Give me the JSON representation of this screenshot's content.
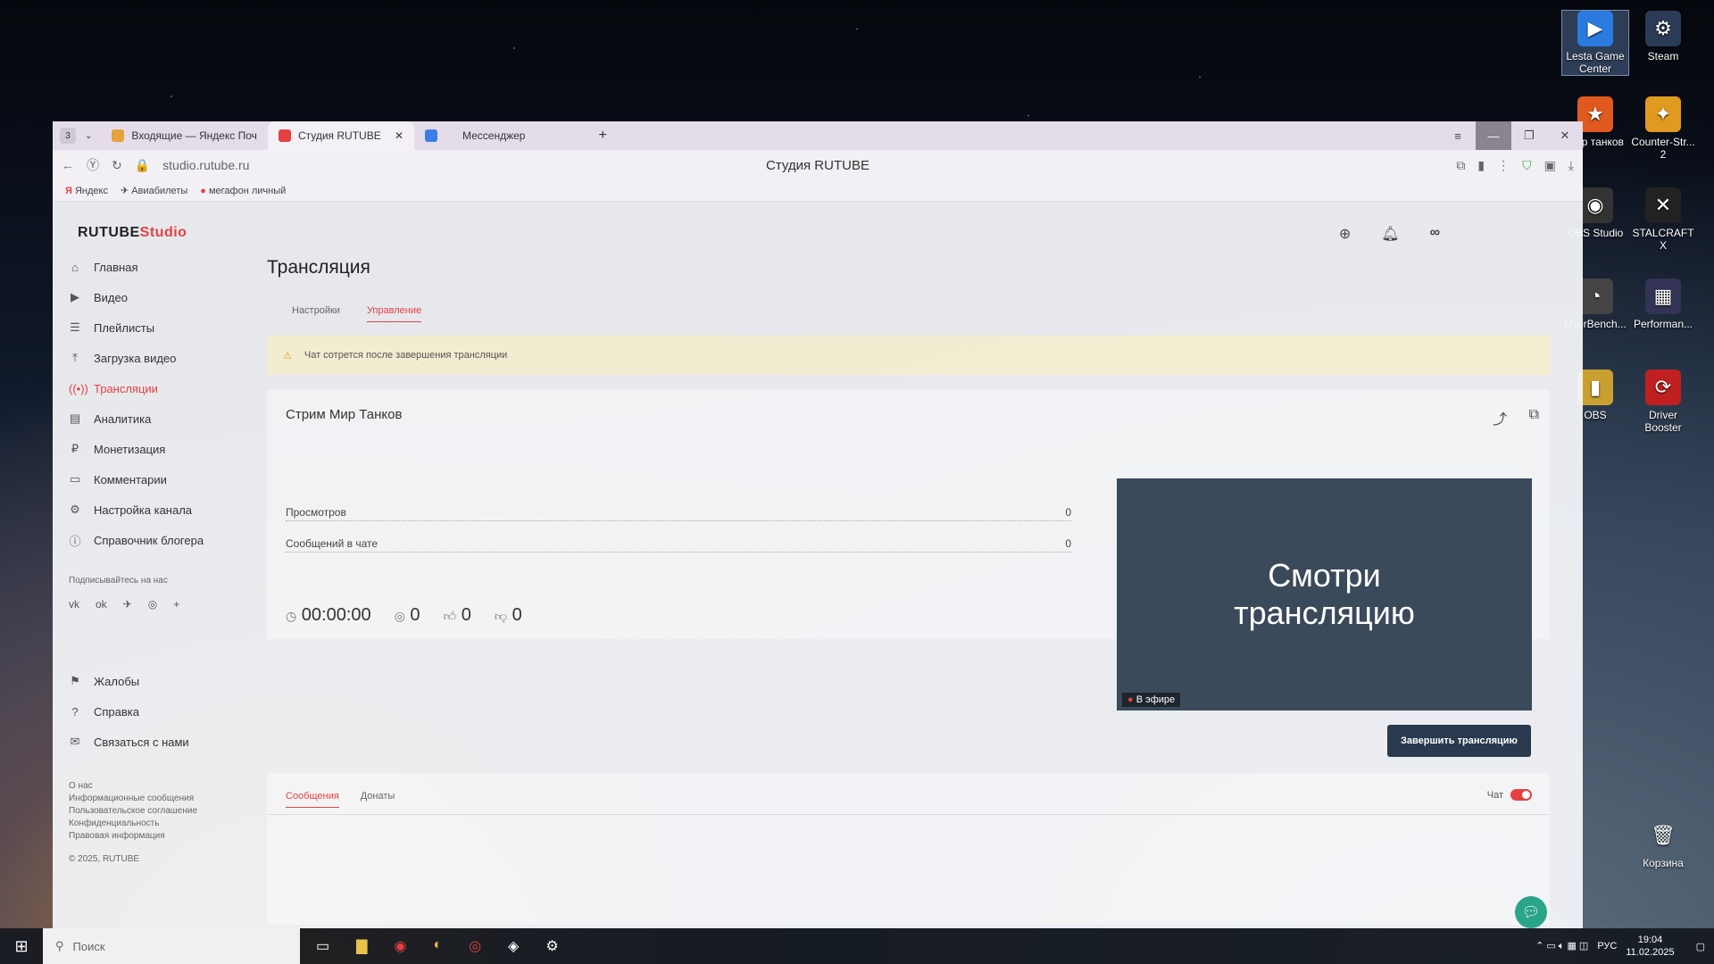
{
  "desktop": {
    "icons": [
      {
        "label": "Lesta Game Center",
        "glyph": "▶",
        "color": "#2a7ae0"
      },
      {
        "label": "Steam",
        "glyph": "⚙",
        "color": "#2a3b55"
      },
      {
        "label": "Мир танков",
        "glyph": "★",
        "color": "#e05a20"
      },
      {
        "label": "Counter-Str... 2",
        "glyph": "✦",
        "color": "#e09a20"
      },
      {
        "label": "OBS Studio",
        "glyph": "◉",
        "color": "#333"
      },
      {
        "label": "STALCRAFT X",
        "glyph": "✕",
        "color": "#222"
      },
      {
        "label": "UserBench...",
        "glyph": "◔",
        "color": "#444"
      },
      {
        "label": "Performan...",
        "glyph": "▦",
        "color": "#335"
      },
      {
        "label": "OBS",
        "glyph": "▮",
        "color": "#c9a030"
      },
      {
        "label": "Driver Booster",
        "glyph": "⟳",
        "color": "#c02020"
      },
      {
        "label": "Корзина",
        "glyph": "🗑",
        "color": "transparent"
      }
    ]
  },
  "browser": {
    "tab_count": "3",
    "tabs": [
      {
        "label": "Входящие — Яндекс Поч"
      },
      {
        "label": "Студия RUTUBE"
      },
      {
        "label": "Мессенджер"
      }
    ],
    "url": "studio.rutube.ru",
    "page_title": "Студия RUTUBE",
    "bookmarks": [
      "Яндекс",
      "Авиабилеты",
      "мегафон личный"
    ]
  },
  "studio": {
    "logo_main": "RUTUBE",
    "logo_accent": "Studio",
    "nav": [
      "Главная",
      "Видео",
      "Плейлисты",
      "Загрузка видео",
      "Трансляции",
      "Аналитика",
      "Монетизация",
      "Комментарии",
      "Настройка канала",
      "Справочник блогера"
    ],
    "subscribe_label": "Подписывайтесь на нас",
    "social": [
      "vk",
      "ok",
      "tg",
      "wa",
      "+"
    ],
    "bottom_nav": [
      "Жалобы",
      "Справка",
      "Связаться с нами"
    ],
    "footer_links": [
      "О нас",
      "Информационные сообщения",
      "Пользовательское соглашение",
      "Конфиденциальность",
      "Правовая информация"
    ],
    "copyright": "© 2025, RUTUBE",
    "heading": "Трансляция",
    "tabs": [
      "Настройки",
      "Управление"
    ],
    "warning": "Чат сотрется после завершения трансляции",
    "stream_title": "Стрим Мир Танков",
    "stats": [
      {
        "label": "Просмотров",
        "value": "0"
      },
      {
        "label": "Сообщений в чате",
        "value": "0"
      }
    ],
    "timer": "00:00:00",
    "viewers": "0",
    "likes": "0",
    "dislikes": "0",
    "preview_text": "Смотри трансляцию",
    "live_badge": "В эфире",
    "end_button": "Завершить трансляцию",
    "chat_tabs": [
      "Сообщения",
      "Донаты"
    ],
    "chat_label": "Чат"
  },
  "taskbar": {
    "search_placeholder": "Поиск",
    "lang": "РУС",
    "time": "19:04",
    "date": "11.02.2025"
  },
  "colors": {
    "accent": "#e64141",
    "dark": "#2a3a4e"
  }
}
